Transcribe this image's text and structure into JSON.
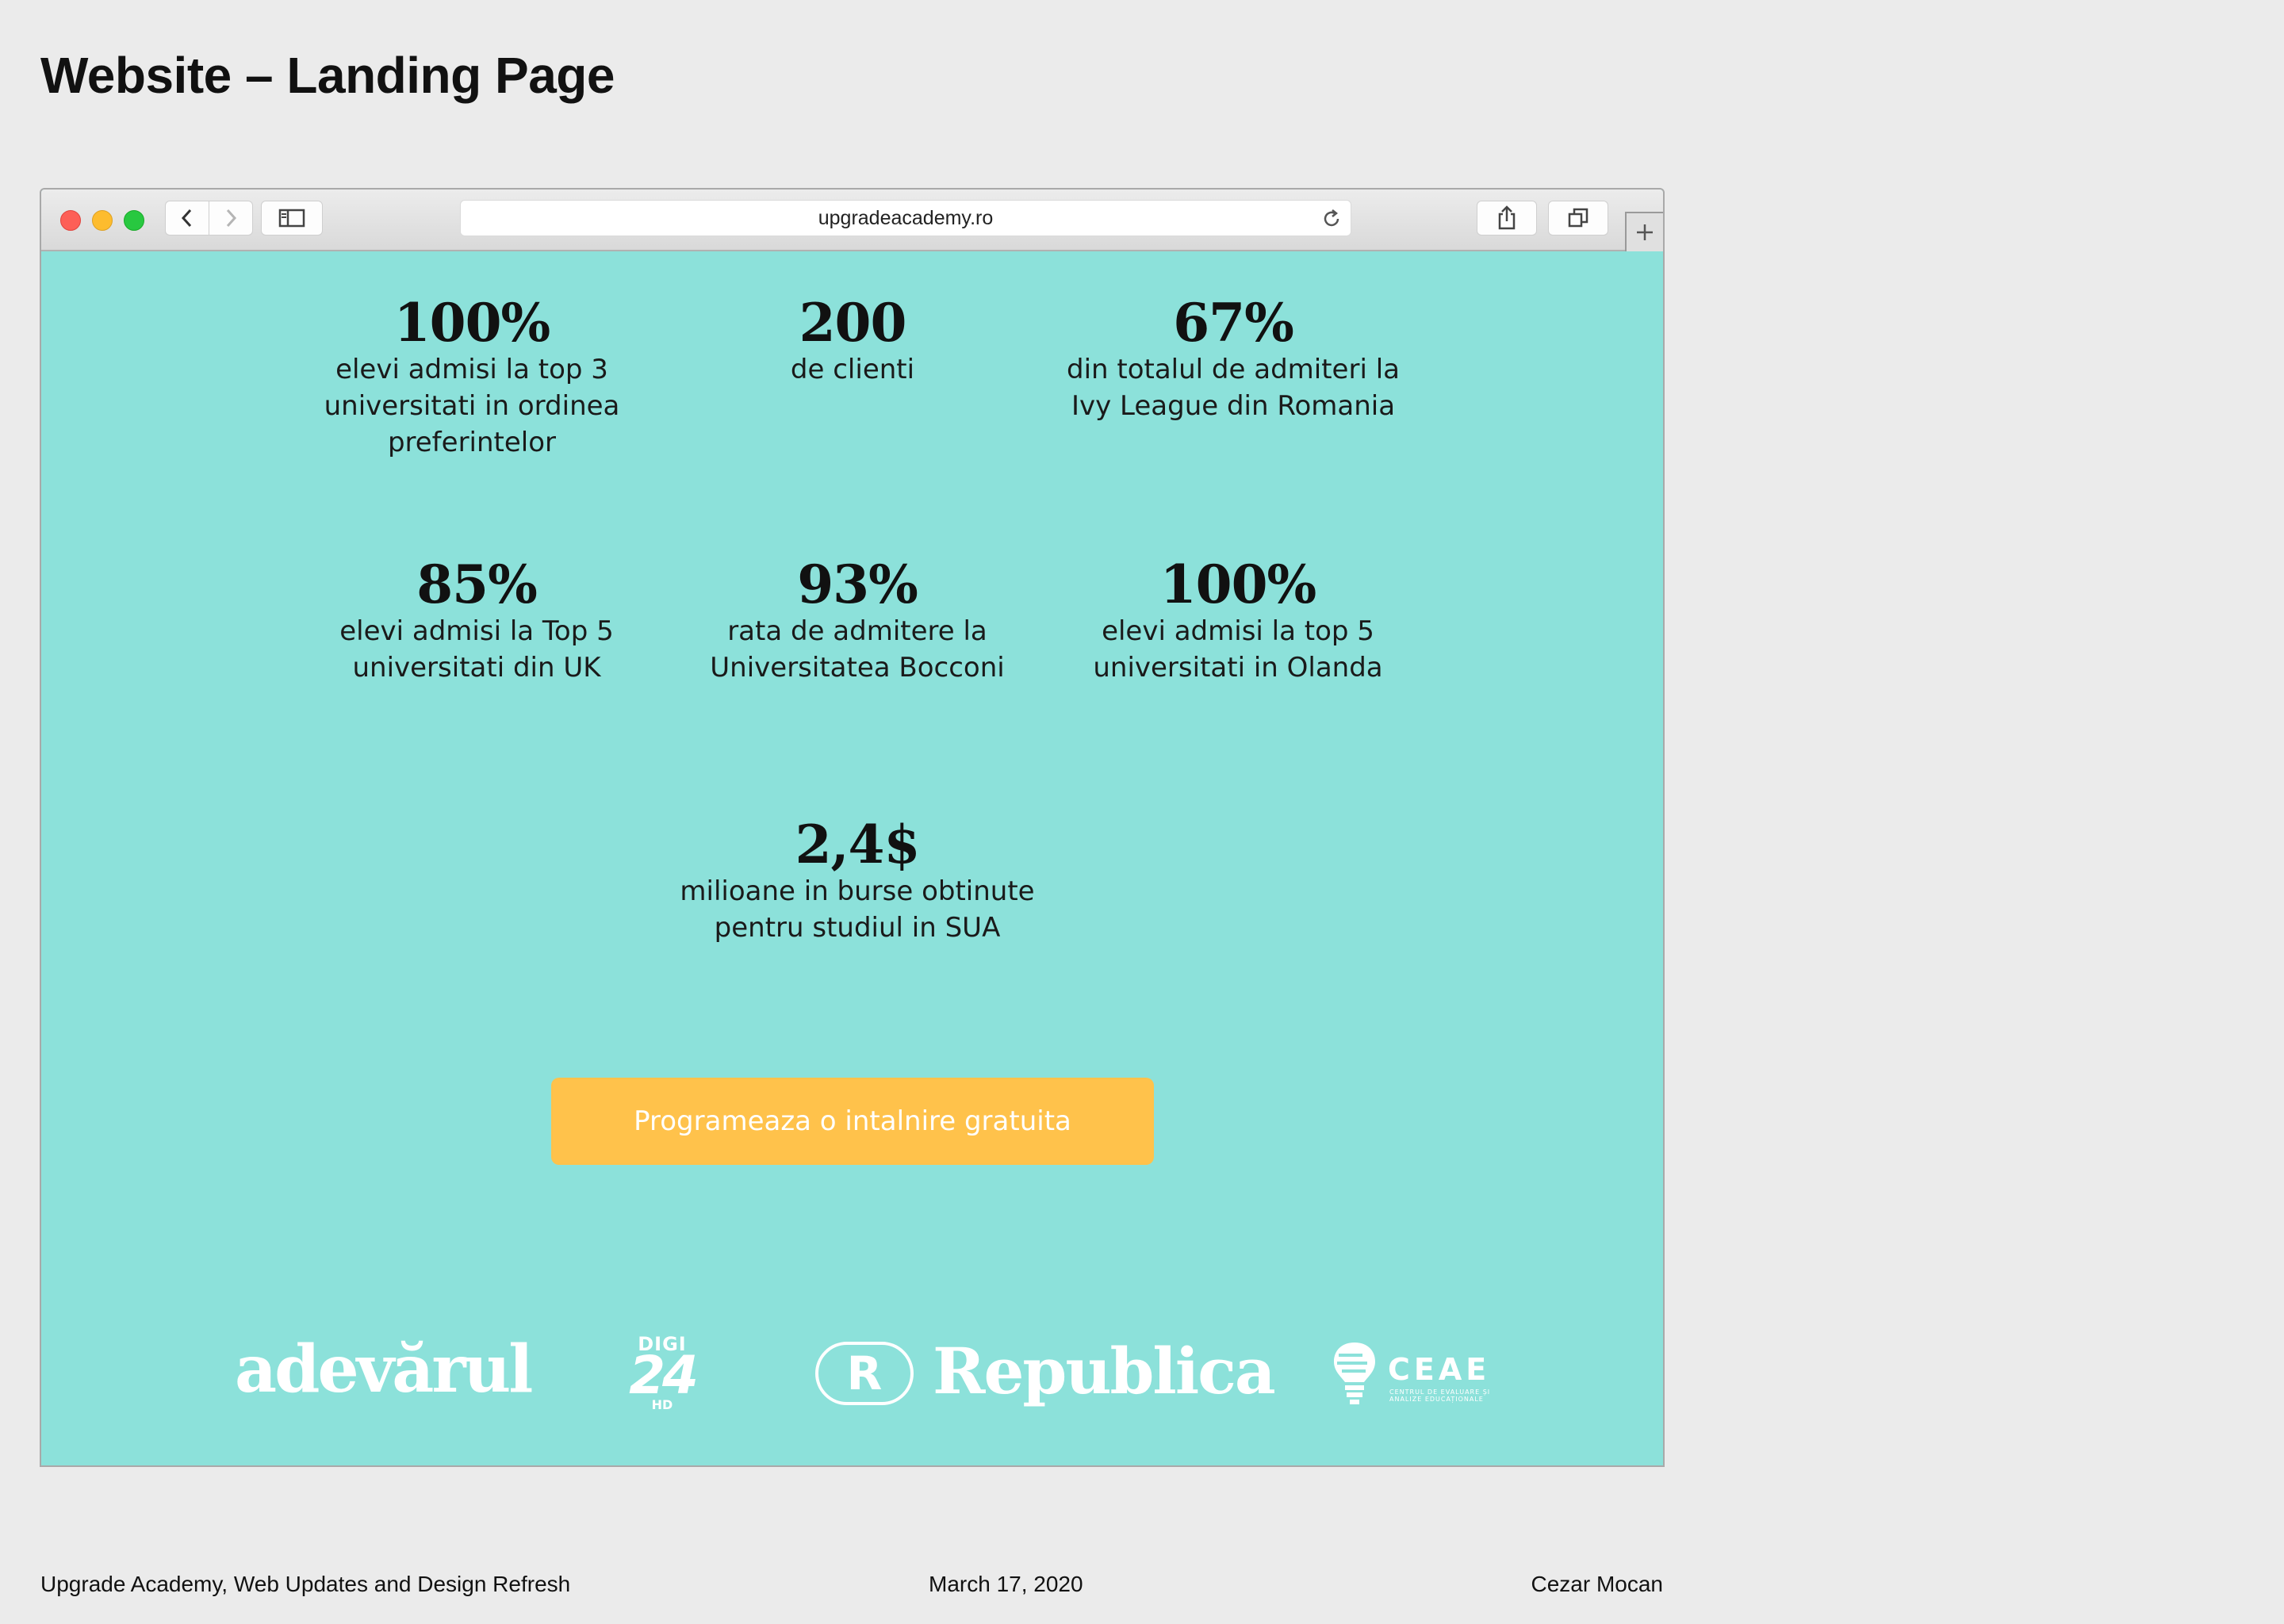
{
  "page": {
    "title": "Website – Landing Page"
  },
  "browser": {
    "url": "upgradeacademy.ro",
    "icons": [
      "close-dot",
      "minimize-dot",
      "zoom-dot",
      "chevron-left-icon",
      "chevron-right-icon",
      "sidebar-icon",
      "reload-icon",
      "share-icon",
      "tabs-icon",
      "plus-icon"
    ]
  },
  "stats": [
    {
      "value": "100%",
      "label": "elevi admisi la top 3 universitati in ordinea preferintelor"
    },
    {
      "value": "200",
      "label": "de clienti"
    },
    {
      "value": "67%",
      "label": "din totalul de admiteri la Ivy League din Romania"
    },
    {
      "value": "85%",
      "label": "elevi admisi la Top 5 universitati din UK"
    },
    {
      "value": "93%",
      "label": "rata de admitere la Universitatea Bocconi"
    },
    {
      "value": "100%",
      "label": "elevi admisi la top 5 universitati in Olanda"
    },
    {
      "value": "2,4$",
      "label": "milioane in burse obtinute pentru studiul in SUA"
    }
  ],
  "cta": {
    "label": "Programeaza o intalnire gratuita"
  },
  "logos": {
    "adevarul": "adevărul",
    "digi_top": "DIGI",
    "digi_number": "24",
    "digi_hd": "HD",
    "republica_mark": "R",
    "republica": "Republica",
    "ceae": "CEAE",
    "ceae_sub": "CENTRUL DE EVALUARE ȘI ANALIZE EDUCAȚIONALE"
  },
  "footer": {
    "project": "Upgrade Academy, Web Updates and Design Refresh",
    "date": "March 17, 2020",
    "author": "Cezar Mocan"
  },
  "colors": {
    "background": "#ebebeb",
    "site_background": "#8ce1da",
    "cta": "#ffc24b",
    "text": "#111111"
  }
}
